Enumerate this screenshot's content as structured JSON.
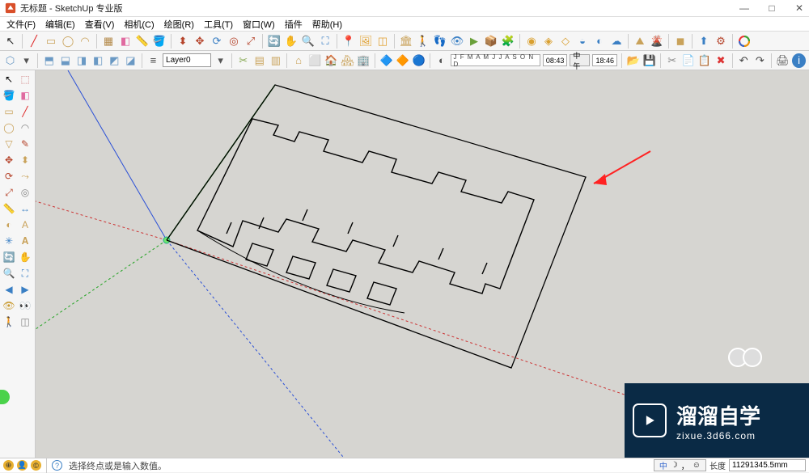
{
  "window": {
    "title": "无标题 - SketchUp 专业版",
    "minimize": "—",
    "maximize": "□",
    "close": "✕"
  },
  "menu": {
    "file": "文件(F)",
    "edit": "编辑(E)",
    "view": "查看(V)",
    "camera": "相机(C)",
    "draw": "绘图(R)",
    "tools": "工具(T)",
    "window": "窗口(W)",
    "extensions": "插件",
    "help": "帮助(H)"
  },
  "layer": {
    "current": "Layer0"
  },
  "shadow": {
    "months": "J F M A M J J A S O N D",
    "date": "08:43",
    "noon": "中午",
    "time2": "18:46"
  },
  "status": {
    "hint": "选择终点或是输入数值。",
    "dim_label": "长度",
    "dim_value": "11291345.5mm",
    "geo_ch": "中",
    "geo_moon": "☽",
    "geo_comma": "，",
    "geo_smile": "☺"
  },
  "watermark": {
    "big": "溜溜自学",
    "small": "zixue.3d66.com"
  },
  "icons": {
    "select": "↖",
    "eraser": "◧",
    "line": "✎",
    "rect": "▭",
    "circle": "◯",
    "arc": "◠",
    "paint": "🪣",
    "pushpull": "⬍",
    "move": "✥",
    "rotate": "⟳",
    "offset": "◎",
    "tape": "📏",
    "text": "A",
    "dim": "↔",
    "orbit": "🔄",
    "pan": "✋",
    "zoom": "🔍",
    "zoomext": "⛶",
    "prev": "◀",
    "house": "🏠",
    "man": "🚶",
    "globe": "🌐",
    "warehouse": "📦",
    "gear": "⚙",
    "info": "ℹ",
    "plugin": "🧩",
    "undo": "↶",
    "redo": "↷",
    "save": "💾",
    "cut": "✂",
    "copy": "📄",
    "paste": "📋",
    "print": "🖨",
    "del": "✖"
  }
}
